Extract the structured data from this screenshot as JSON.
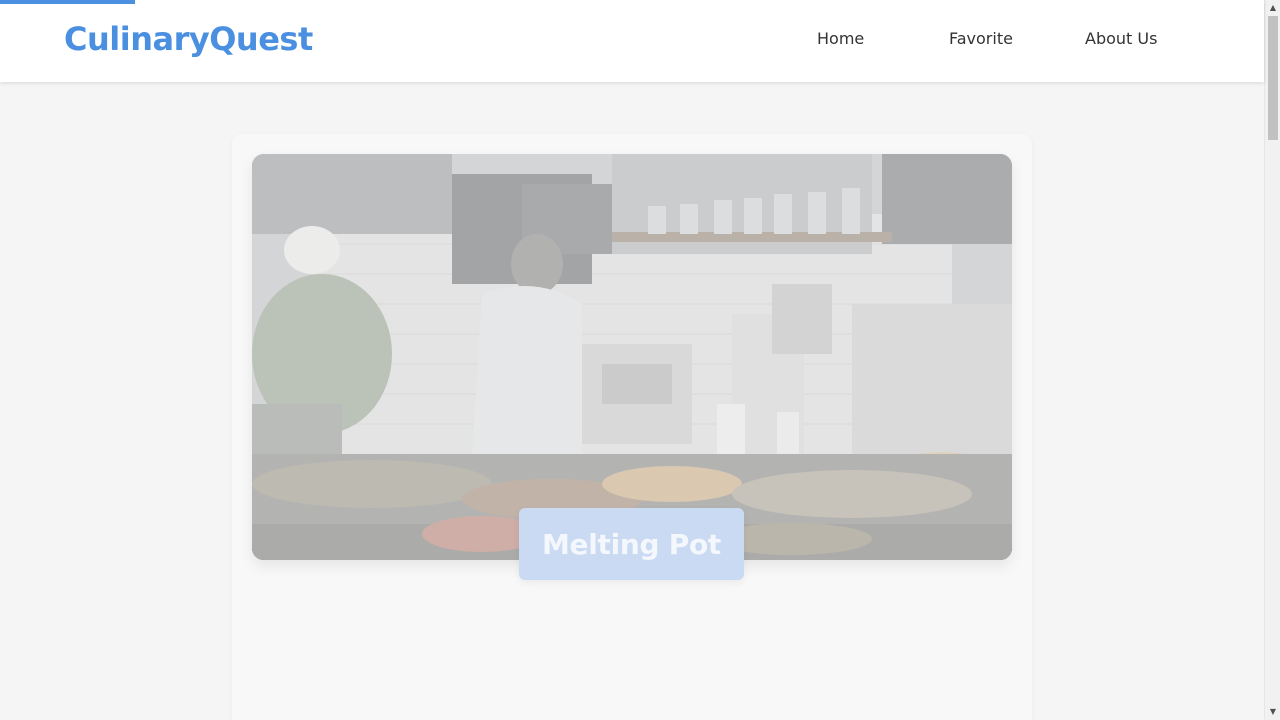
{
  "header": {
    "brand": "CulinaryQuest",
    "nav": [
      "Home",
      "Favorite",
      "About Us"
    ]
  },
  "page_progress": 0.105,
  "hero": {
    "image_description_icon": "kitchen-photo",
    "title": "Melting Pot"
  },
  "colors": {
    "brand": "#4a8fe0",
    "badge": "#c9daf2",
    "background": "#f5f5f5"
  }
}
